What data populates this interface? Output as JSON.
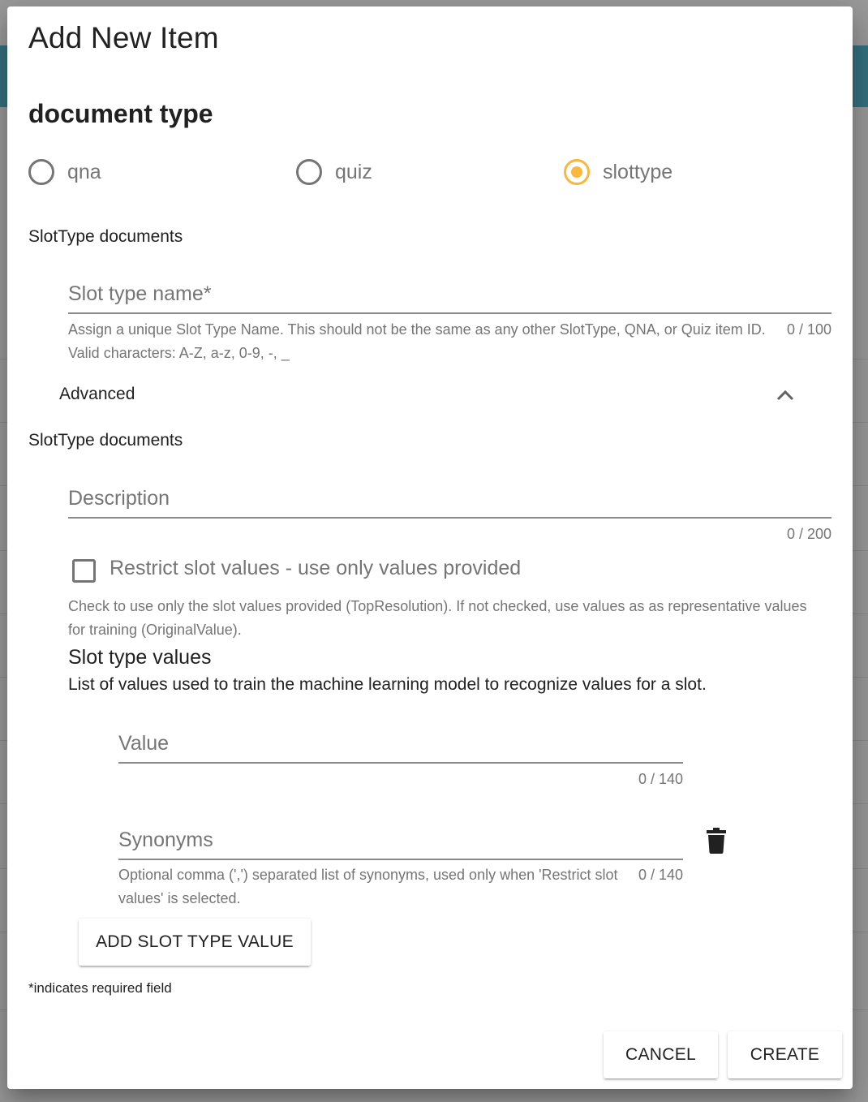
{
  "dialog": {
    "title": "Add New Item",
    "section_title": "document type",
    "accent_color": "#f9b83d"
  },
  "doc_types": [
    {
      "label": "qna",
      "checked": false
    },
    {
      "label": "quiz",
      "checked": false
    },
    {
      "label": "slottype",
      "checked": true
    }
  ],
  "slottype": {
    "heading_1": "SlotType documents",
    "name_field": {
      "placeholder": "Slot type name*",
      "value": "",
      "hint": "Assign a unique Slot Type Name. This should not be the same as any other SlotType, QNA, or Quiz item ID. Valid characters: A-Z, a-z, 0-9, -, _",
      "counter": "0 / 100"
    },
    "advanced_label": "Advanced",
    "heading_2": "SlotType documents",
    "description_field": {
      "placeholder": "Description",
      "value": "",
      "counter": "0 / 200"
    },
    "restrict": {
      "label": "Restrict slot values - use only values provided",
      "checked": false,
      "hint": "Check to use only the slot values provided (TopResolution). If not checked, use values as as representative values for training (OriginalValue)."
    },
    "values_title": "Slot type values",
    "values_desc": "List of values used to train the machine learning model to recognize values for a slot.",
    "value_field": {
      "placeholder": "Value",
      "value": "",
      "counter": "0 / 140"
    },
    "synonyms_field": {
      "placeholder": "Synonyms",
      "value": "",
      "hint": "Optional comma (',') separated list of synonyms, used only when 'Restrict slot values' is selected.",
      "counter": "0 / 140"
    },
    "add_value_button": "ADD SLOT TYPE VALUE"
  },
  "footer": {
    "required_note": "*indicates required field",
    "cancel_label": "CANCEL",
    "create_label": "CREATE"
  },
  "icons": {
    "advanced_toggle": "chevron-up-icon",
    "delete_value": "trash-icon"
  }
}
